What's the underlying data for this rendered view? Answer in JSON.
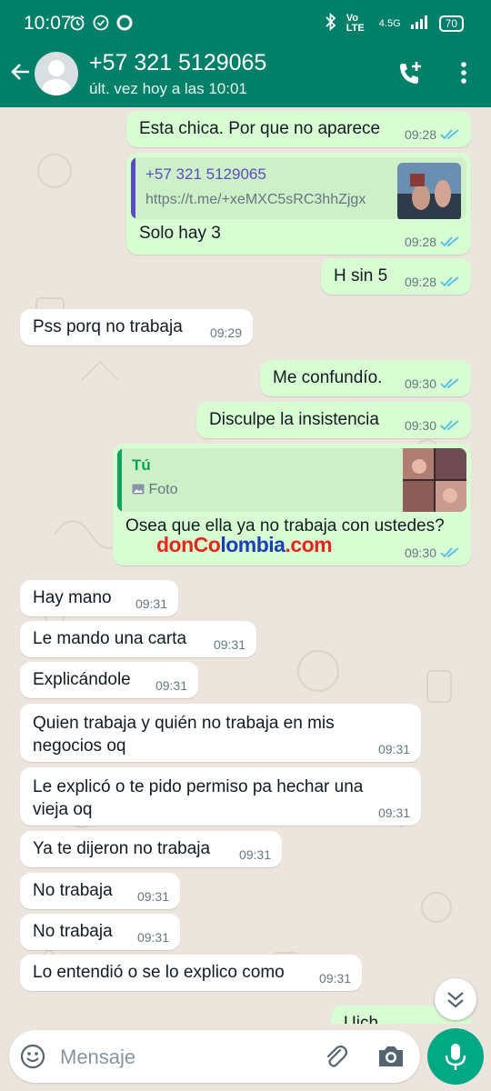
{
  "status_bar": {
    "time": "10:07",
    "network": "4.5G",
    "volte": "Vo LTE",
    "battery": "70"
  },
  "header": {
    "contact_name": "+57 321 5129065",
    "last_seen": "últ. vez hoy a las 10:01"
  },
  "messages": [
    {
      "dir": "out",
      "text": "Esta chica. Por que no aparece",
      "time": "09:28"
    },
    {
      "dir": "out",
      "link_title": "+57 321 5129065",
      "link_url": "https://t.me/+xeMXC5sRC3hhZjgx",
      "text": "Solo hay 3",
      "time": "09:28"
    },
    {
      "dir": "out",
      "text": "H sin 5",
      "time": "09:28"
    },
    {
      "dir": "in",
      "text": "Pss porq no trabaja",
      "time": "09:29"
    },
    {
      "dir": "out",
      "text": "Me confundío.",
      "time": "09:30"
    },
    {
      "dir": "out",
      "text": "Disculpe la insistencia",
      "time": "09:30"
    },
    {
      "dir": "out",
      "quote_author": "Tú",
      "quote_type": "Foto",
      "text": "Osea que ella ya no trabaja con ustedes?",
      "time": "09:30"
    },
    {
      "dir": "in",
      "text": "Hay mano",
      "time": "09:31"
    },
    {
      "dir": "in",
      "text": "Le mando una carta",
      "time": "09:31"
    },
    {
      "dir": "in",
      "text": "Explicándole",
      "time": "09:31"
    },
    {
      "dir": "in",
      "text": "Quien trabaja y quién no trabaja en mis negocios oq",
      "time": "09:31"
    },
    {
      "dir": "in",
      "text": "Le explicó o te pido permiso pa hechar una vieja oq",
      "time": "09:31"
    },
    {
      "dir": "in",
      "text": "Ya te dijeron no trabaja",
      "time": "09:31"
    },
    {
      "dir": "in",
      "text": "No trabaja",
      "time": "09:31"
    },
    {
      "dir": "in",
      "text": "No trabaja",
      "time": "09:31"
    },
    {
      "dir": "in",
      "text": "Lo entendió o se lo explico como",
      "time": "09:31"
    },
    {
      "dir": "out",
      "text": "Uich",
      "time": ""
    }
  ],
  "watermark": {
    "part1": "donCo",
    "part2": "lombia",
    "part3": ".com"
  },
  "composer": {
    "placeholder": "Mensaje"
  },
  "colors": {
    "header": "#008069",
    "outgoing_bubble": "#d9fdd3",
    "incoming_bubble": "#ffffff",
    "read_ticks": "#53bdeb",
    "link_accent": "#5b4bc4",
    "quote_accent": "#06a35a",
    "mic_button": "#00a884",
    "watermark_red": "#e0281c",
    "watermark_blue": "#1a3fb5"
  }
}
